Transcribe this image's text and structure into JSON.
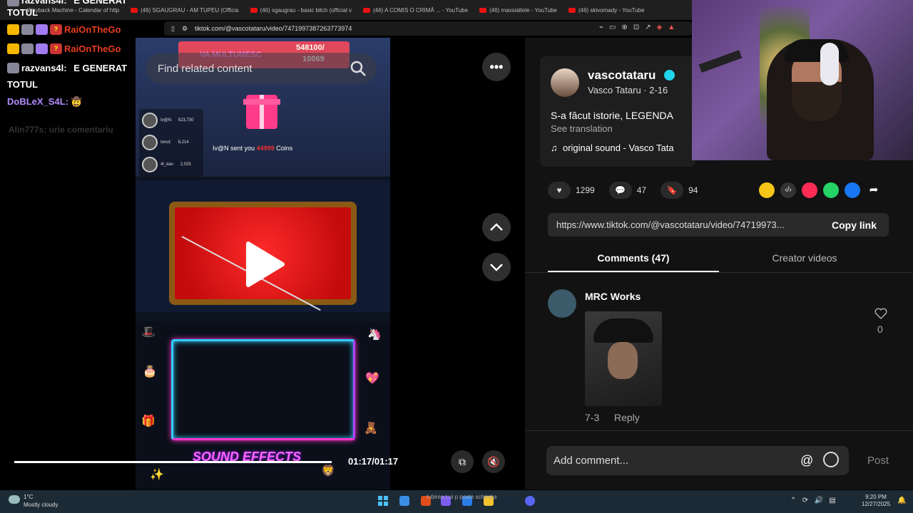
{
  "browser": {
    "tabs": [
      "Wayback Machine - Calendar of http",
      "(46) SGAUGRAU - AM TUPEU (Officia",
      "(46) sgaugrau - basic bitch (official v",
      "(46) A COMIS O CRIMĂ ... - YouTube",
      "(46) maxsialtele - YouTube",
      "(46) skivomady - YouTube"
    ],
    "url": "tiktok.com/@vascotataru/video/7471997387263773974"
  },
  "overlay_chat": {
    "lines": [
      {
        "user": "razvans4l:",
        "text": "E GENERAT"
      },
      {
        "user": "",
        "text": "TOTUL"
      },
      {
        "user": "RaiOnTheGo",
        "text": ""
      },
      {
        "user": "RaiOnTheGo",
        "text": ""
      },
      {
        "user": "razvans4l:",
        "text": "E GENERAT"
      },
      {
        "user": "",
        "text": "TOTUL"
      },
      {
        "user": "DoBLeX_S4L:",
        "text": ""
      }
    ],
    "faded": "Alin777s: urie comentariu"
  },
  "video": {
    "search_placeholder": "Find related content",
    "tip_banner": "VA MULTUMESC",
    "tip_amount_top": "548100/",
    "tip_amount_bottom": "10069",
    "leaderboard": [
      {
        "name": "Iv@N",
        "value": "523,730"
      },
      {
        "name": "Ionut:",
        "value": "6,214"
      },
      {
        "name": "4l_dan",
        "value": "2,025"
      }
    ],
    "sent_text_user": "Iv@N",
    "sent_text_mid": "sent you",
    "sent_text_amount": "44999",
    "sent_text_end": "Coins",
    "sound_effects": "SOUND EFFECTS",
    "time": "01:17/01:17",
    "progress": 1.0
  },
  "post": {
    "username": "vascotataru",
    "nickname": "Vasco Tataru · 2-16",
    "description": "S-a făcut istorie, LEGENDA",
    "see_translation": "See translation",
    "music": "original sound - Vasco Tata",
    "likes": "1299",
    "comments": "47",
    "saves": "94",
    "link": "https://www.tiktok.com/@vascotataru/video/74719973...",
    "copy_link": "Copy link"
  },
  "tabs": {
    "comments": "Comments (47)",
    "creator": "Creator videos"
  },
  "comment": {
    "author": "MRC Works",
    "date": "7-3",
    "reply": "Reply",
    "likes": "0"
  },
  "composer": {
    "placeholder": "Add comment...",
    "at": "@",
    "post": "Post"
  },
  "taskbar": {
    "temp": "1°C",
    "weather": "Mostly cloudy",
    "media_text": "Iubirea Lui p poate schimba",
    "time": "9:20 PM",
    "date": "12/27/2025"
  },
  "colors": {
    "tiktok_cyan": "#20d5ec",
    "background": "#121212",
    "chat_red": "#e83c1f",
    "chat_purple": "#b38cff"
  }
}
